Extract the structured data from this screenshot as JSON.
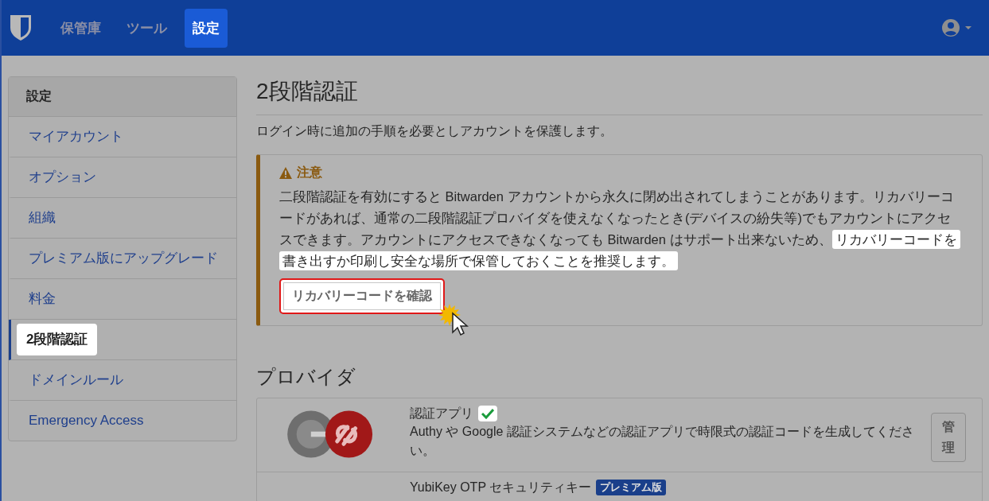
{
  "nav": {
    "tabs": [
      {
        "label": "保管庫",
        "selected": false
      },
      {
        "label": "ツール",
        "selected": false
      },
      {
        "label": "設定",
        "selected": true
      }
    ]
  },
  "sidebar": {
    "title": "設定",
    "items": [
      {
        "label": "マイアカウント",
        "selected": false
      },
      {
        "label": "オプション",
        "selected": false
      },
      {
        "label": "組織",
        "selected": false
      },
      {
        "label": "プレミアム版にアップグレード",
        "selected": false
      },
      {
        "label": "料金",
        "selected": false
      },
      {
        "label": "2段階認証",
        "selected": true
      },
      {
        "label": "ドメインルール",
        "selected": false
      },
      {
        "label": "Emergency Access",
        "selected": false
      }
    ]
  },
  "page": {
    "title": "2段階認証",
    "description": "ログイン時に追加の手順を必要としアカウントを保護します。"
  },
  "warning": {
    "title": "注意",
    "text": "二段階認証を有効にすると Bitwarden アカウントから永久に閉め出されてしまうことがあります。リカバリーコードがあれば、通常の二段階認証プロバイダを使えなくなったとき(デバイスの紛失等)でもアカウントにアクセスできます。アカウントにアクセスできなくなっても Bitwarden はサポート出来ないため、",
    "highlighted_text": "リカバリーコードを書き出すか印刷し安全な場所で保管しておくことを推奨します。",
    "button": "リカバリーコードを確認"
  },
  "providers": {
    "title": "プロバイダ",
    "items": [
      {
        "name": "認証アプリ",
        "enabled": true,
        "description": "Authy や Google 認証システムなどの認証アプリで時限式の認証コードを生成してください。",
        "button": "管理"
      },
      {
        "name": "YubiKey OTP セキュリティキー",
        "enabled": false,
        "badge": "プレミアム版"
      }
    ]
  }
}
